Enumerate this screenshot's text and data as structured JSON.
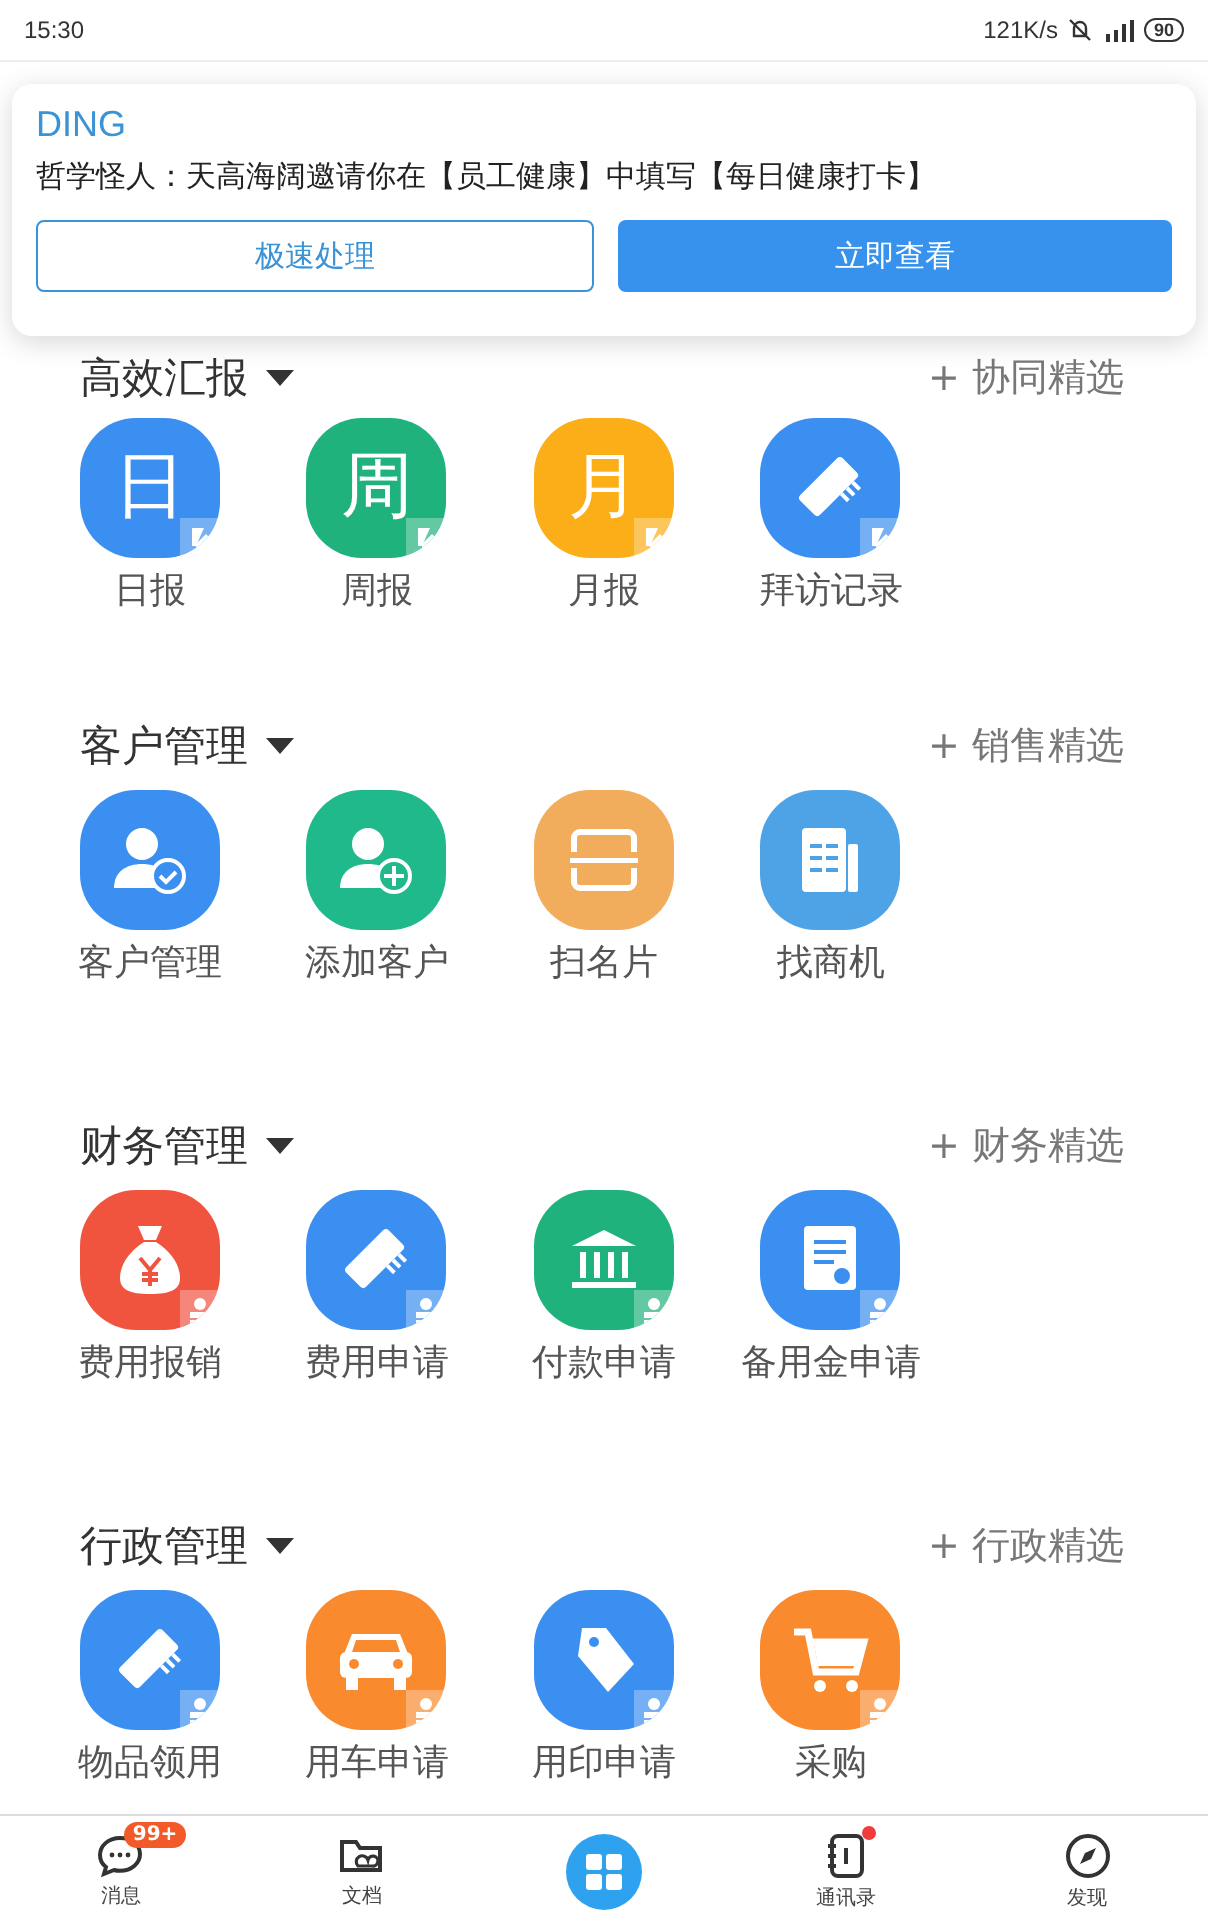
{
  "status_bar": {
    "time": "15:30",
    "speed": "121K/s",
    "battery": "90"
  },
  "notification": {
    "app": "DING",
    "message": "哲学怪人：天高海阔邀请你在【员工健康】中填写【每日健康打卡】",
    "buttons": [
      {
        "label": "极速处理",
        "kind": "outline"
      },
      {
        "label": "立即查看",
        "kind": "primary"
      }
    ]
  },
  "sections": [
    {
      "title": "高效汇报",
      "kind": "report",
      "action": "+ 协同精选",
      "apps": [
        {
          "label": "日报",
          "color": "#3b8ff0",
          "kind": "glyph",
          "glyph": "日"
        },
        {
          "label": "周报",
          "color": "#1fb27c",
          "kind": "glyph",
          "glyph": "周"
        },
        {
          "label": "月报",
          "color": "#fbae17",
          "kind": "glyph",
          "glyph": "月"
        },
        {
          "label": "拜访记录",
          "color": "#3b8ff0",
          "kind": "strip"
        }
      ]
    },
    {
      "title": "客户管理",
      "kind": "plain",
      "action": "+ 销售精选",
      "apps": [
        {
          "label": "客户管理",
          "color": "#3b8ff0",
          "kind": "person-check"
        },
        {
          "label": "添加客户",
          "color": "#1fb98c",
          "kind": "person-add"
        },
        {
          "label": "扫名片",
          "color": "#f2ad5c",
          "kind": "scan"
        },
        {
          "label": "找商机",
          "color": "#4ea3e6",
          "kind": "document"
        }
      ]
    },
    {
      "title": "财务管理",
      "kind": "approval",
      "action": "+ 财务精选",
      "apps": [
        {
          "label": "费用报销",
          "color": "#f0543f",
          "kind": "money-bag"
        },
        {
          "label": "费用申请",
          "color": "#3b8ff0",
          "kind": "strip"
        },
        {
          "label": "付款申请",
          "color": "#1fb27c",
          "kind": "bank"
        },
        {
          "label": "备用金申请",
          "color": "#3b8ff0",
          "kind": "certificate"
        }
      ]
    },
    {
      "title": "行政管理",
      "kind": "approval",
      "action": "+ 行政精选",
      "apps": [
        {
          "label": "物品领用",
          "color": "#3b8ff0",
          "kind": "strip"
        },
        {
          "label": "用车申请",
          "color": "#fa8a2e",
          "kind": "car"
        },
        {
          "label": "用印申请",
          "color": "#3b8ff0",
          "kind": "tag"
        },
        {
          "label": "采购",
          "color": "#fa8a2e",
          "kind": "cart"
        }
      ]
    }
  ],
  "tab_bar": [
    {
      "label": "消息",
      "kind": "chat",
      "badge": "99+",
      "dot": false
    },
    {
      "label": "文档",
      "kind": "folder",
      "dot": false
    },
    {
      "kind": "grid",
      "dot": false
    },
    {
      "label": "通讯录",
      "kind": "contacts",
      "dot": true
    },
    {
      "label": "发现",
      "kind": "compass",
      "dot": false
    }
  ]
}
